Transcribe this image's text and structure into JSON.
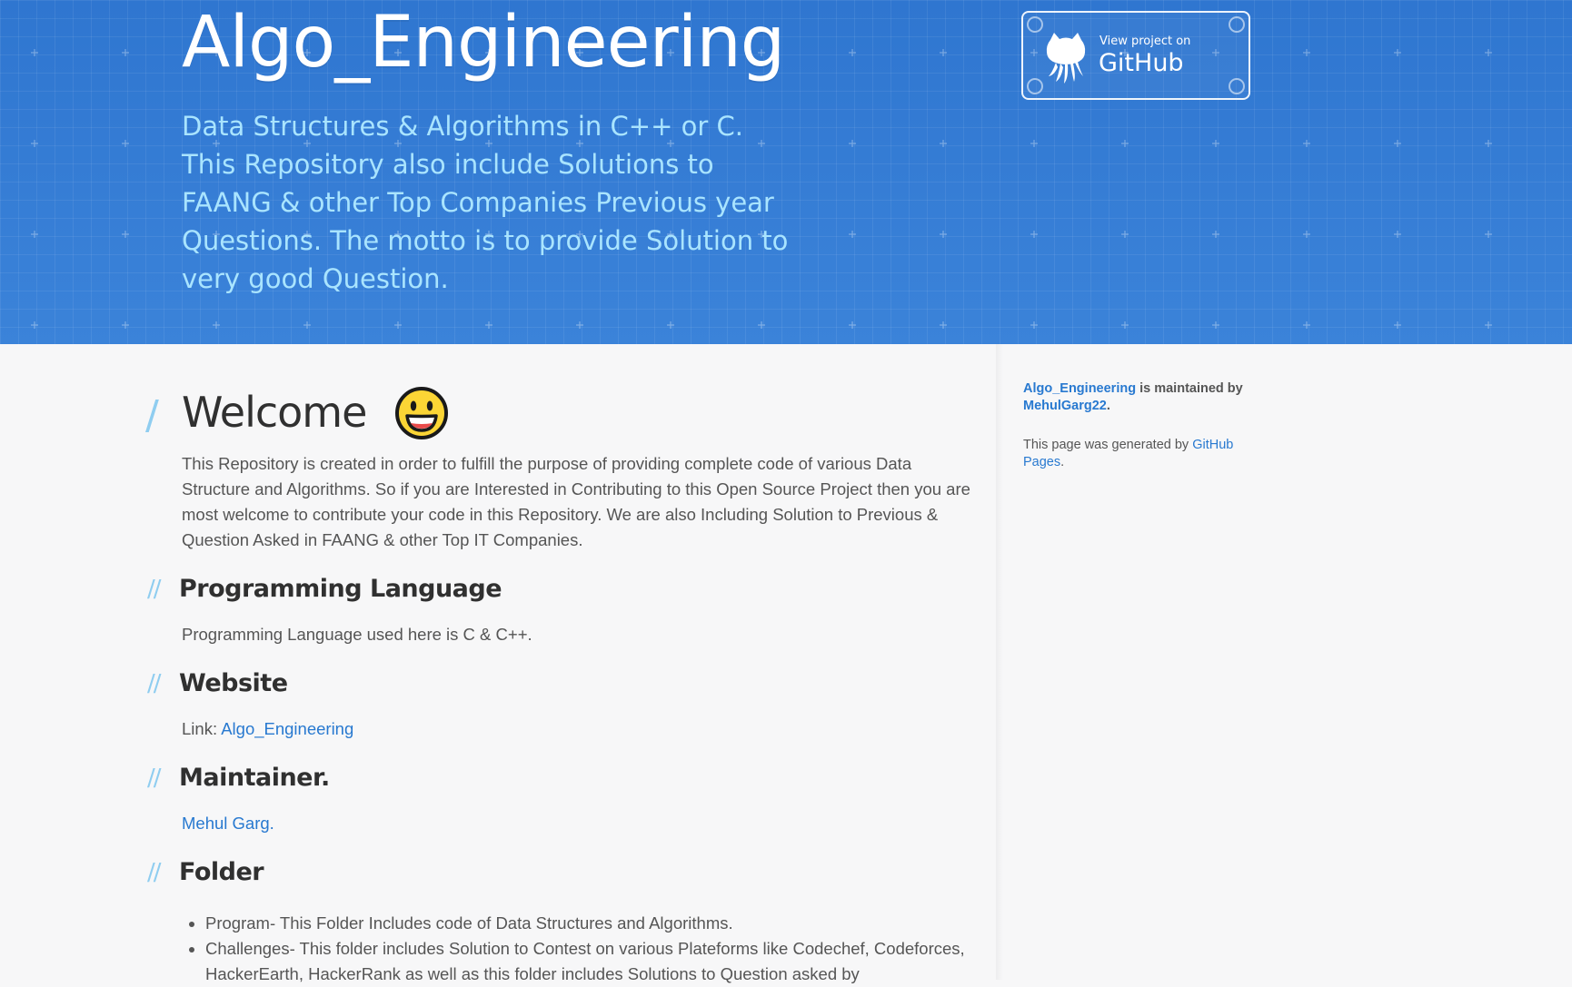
{
  "header": {
    "title": "Algo_Engineering",
    "tagline": "Data Structures & Algorithms in C++ or C. This Repository also include Solutions to FAANG & other Top Companies Previous year Questions. The motto is to provide Solution to very good Question.",
    "github_badge": {
      "small_label": "View project on",
      "big_label": "GitHub",
      "icon": "octocat-icon"
    }
  },
  "main": {
    "welcome": {
      "slash": "/",
      "heading": "Welcome",
      "emoji": "smiley-emoji",
      "paragraph": "This Repository is created in order to fulfill the purpose of providing complete code of various Data Structure and Algorithms. So if you are Interested in Contributing to this Open Source Project then you are most welcome to contribute your code in this Repository. We are also Including Solution to Previous & Question Asked in FAANG & other Top IT Companies."
    },
    "sections": {
      "slash": "//",
      "programming_language": {
        "heading": "Programming Language",
        "text": "Programming Language used here is C & C++."
      },
      "website": {
        "heading": "Website",
        "link_prefix": "Link: ",
        "link_text": "Algo_Engineering"
      },
      "maintainer": {
        "heading": "Maintainer.",
        "link_text": "Mehul Garg."
      },
      "folder": {
        "heading": "Folder",
        "items": [
          "Program- This Folder Includes code of Data Structures and Algorithms.",
          "Challenges- This folder includes Solution to Contest on various Plateforms like Codechef, Codeforces, HackerEarth, HackerRank as well as this folder includes Solutions to Question asked by"
        ]
      }
    }
  },
  "sidebar": {
    "repo_link": "Algo_Engineering",
    "maintained_text": " is maintained by ",
    "owner_link": "MehulGarg22",
    "owner_suffix": ".",
    "generated_prefix": "This page was generated by ",
    "generated_link": "GitHub Pages",
    "generated_suffix": "."
  },
  "colors": {
    "header_bg": "#3a80d6",
    "tagline": "#a9e4ff",
    "link": "#2879d0",
    "slash": "#8fcdf0",
    "page_bg": "#f7f7f8"
  }
}
